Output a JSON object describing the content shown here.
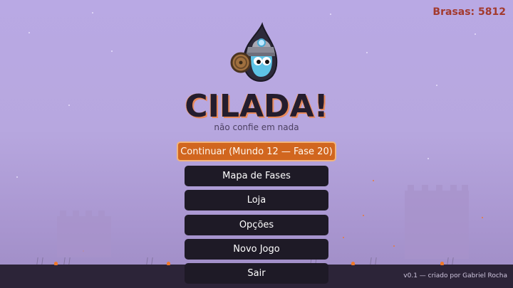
{
  "hud": {
    "currency_label": "Brasas: 5812"
  },
  "title": {
    "text": "CILADA!",
    "subtitle": "não confie em nada"
  },
  "menu": {
    "continue_label": "Continuar  (Mundo 12 — Fase 20)",
    "items": [
      {
        "label": "Mapa de Fases"
      },
      {
        "label": "Loja"
      },
      {
        "label": "Opções"
      },
      {
        "label": "Novo Jogo"
      },
      {
        "label": "Sair"
      }
    ]
  },
  "footer": {
    "credit": "v0.1 — criado por Gabriel Rocha"
  },
  "colors": {
    "accent": "#d1661f",
    "currency": "#a33a2e",
    "button": "#1e1a26",
    "ground": "#2c2438",
    "sky": "#b9a9e4"
  },
  "icons": {
    "mascot": "miner-droplet-mascot-icon"
  }
}
